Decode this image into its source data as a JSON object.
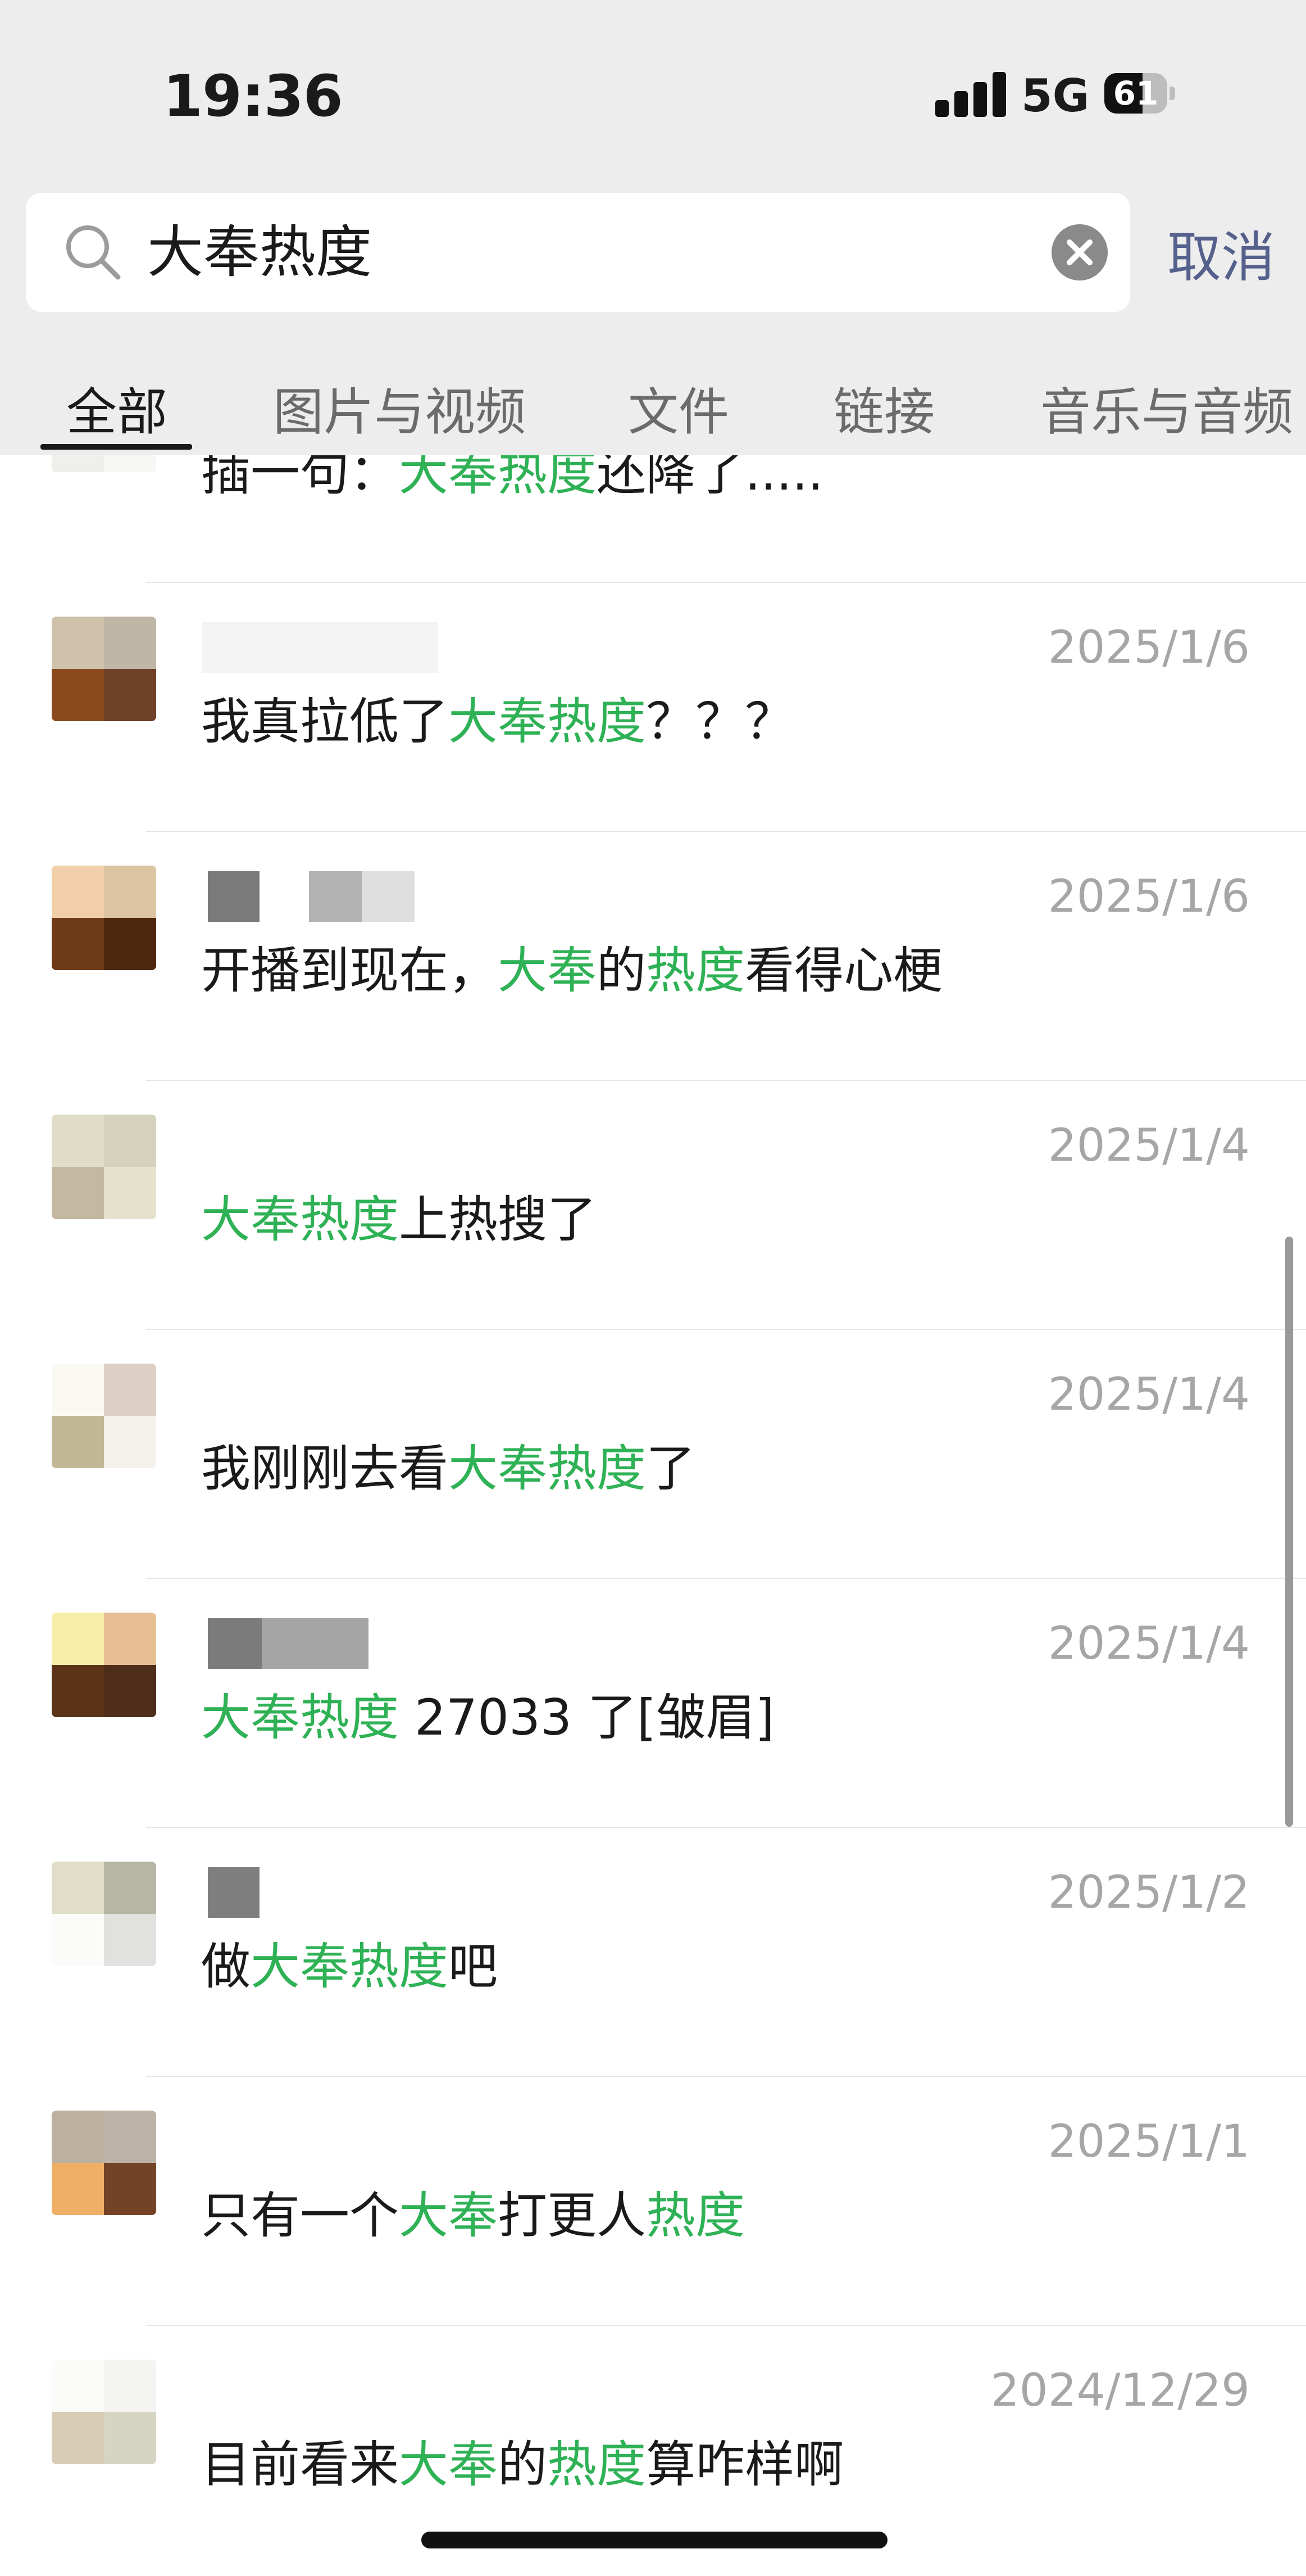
{
  "status_bar": {
    "time": "19:36",
    "network": "5G",
    "battery": "61",
    "battery_level": 0.61
  },
  "search": {
    "query": "大奉热度",
    "cancel_label": "取消"
  },
  "tabs": [
    {
      "label": "全部",
      "active": true
    },
    {
      "label": "图片与视频"
    },
    {
      "label": "文件"
    },
    {
      "label": "链接"
    },
    {
      "label": "音乐与音频"
    }
  ],
  "colors": {
    "highlight": "#2fb156",
    "cancel": "#55618c",
    "date": "#a6a6a6"
  },
  "results": [
    {
      "date": "",
      "segments": [
        {
          "t": "插一句："
        },
        {
          "t": "大奉热度",
          "hl": true
        },
        {
          "t": "还降了....."
        }
      ]
    },
    {
      "date": "2025/1/6",
      "segments": [
        {
          "t": "我真拉低了"
        },
        {
          "t": "大奉热度",
          "hl": true
        },
        {
          "t": "？？？"
        }
      ]
    },
    {
      "date": "2025/1/6",
      "segments": [
        {
          "t": "开播到现在，"
        },
        {
          "t": "大奉",
          "hl": true
        },
        {
          "t": "的"
        },
        {
          "t": "热度",
          "hl": true
        },
        {
          "t": "看得心梗"
        }
      ]
    },
    {
      "date": "2025/1/4",
      "segments": [
        {
          "t": "大奉热度",
          "hl": true
        },
        {
          "t": "上热搜了"
        }
      ]
    },
    {
      "date": "2025/1/4",
      "segments": [
        {
          "t": "我刚刚去看"
        },
        {
          "t": "大奉热度",
          "hl": true
        },
        {
          "t": "了"
        }
      ]
    },
    {
      "date": "2025/1/4",
      "segments": [
        {
          "t": "大奉热度",
          "hl": true
        },
        {
          "t": " 27033 了[皱眉]"
        }
      ]
    },
    {
      "date": "2025/1/2",
      "segments": [
        {
          "t": "做"
        },
        {
          "t": "大奉热度",
          "hl": true
        },
        {
          "t": "吧"
        }
      ]
    },
    {
      "date": "2025/1/1",
      "segments": [
        {
          "t": "只有一个"
        },
        {
          "t": "大奉",
          "hl": true
        },
        {
          "t": "打更人"
        },
        {
          "t": "热度",
          "hl": true
        }
      ]
    },
    {
      "date": "2024/12/29",
      "segments": [
        {
          "t": "目前看来"
        },
        {
          "t": "大奉",
          "hl": true
        },
        {
          "t": "的"
        },
        {
          "t": "热度",
          "hl": true
        },
        {
          "t": "算咋样啊"
        }
      ]
    }
  ]
}
